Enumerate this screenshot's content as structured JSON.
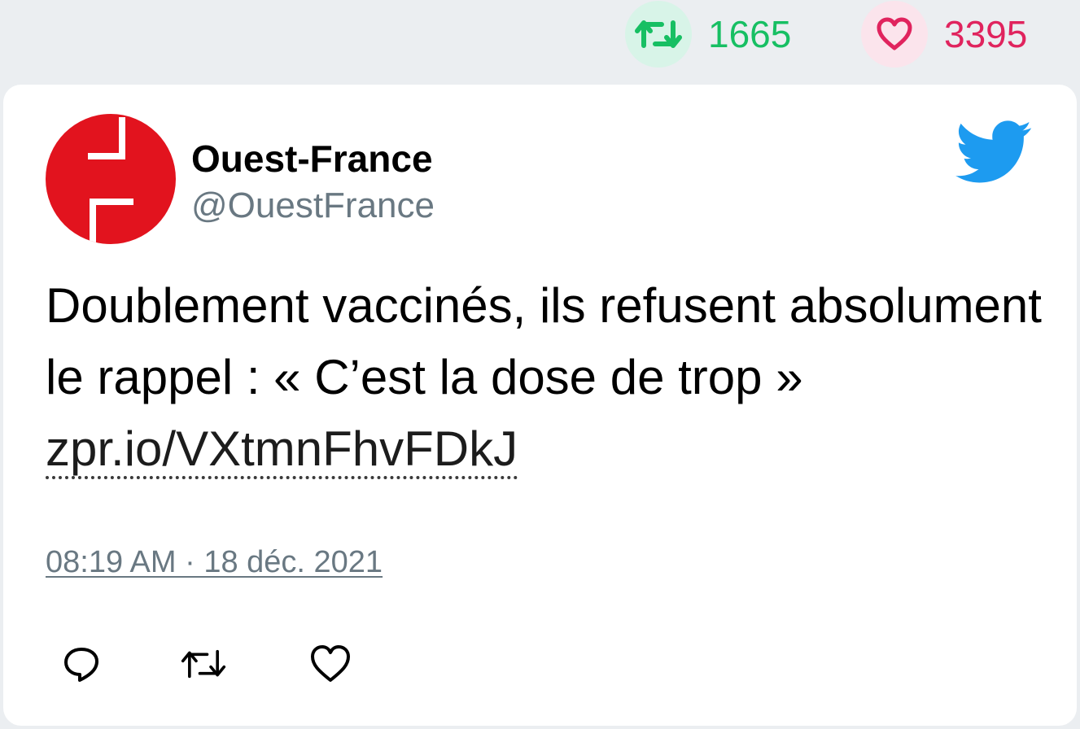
{
  "stats": {
    "retweet_count": "1665",
    "like_count": "3395"
  },
  "author": {
    "name": "Ouest-France",
    "handle": "@OuestFrance",
    "avatar_icon": "ouest-france-logo",
    "avatar_color": "#e2131e"
  },
  "tweet": {
    "text": "Doublement vaccinés, ils refusent absolument le rappel : « C’est la dose de trop » ",
    "link": "zpr.io/VXtmnFhvFDkJ",
    "timestamp": "08:19 AM · 18 déc. 2021"
  },
  "icons": {
    "retweet": "retweet-icon",
    "like": "heart-icon",
    "reply": "reply-icon",
    "brand": "twitter-bird-icon"
  },
  "colors": {
    "retweet_green": "#17bf63",
    "like_red": "#e0245e",
    "twitter_blue": "#1d9bf0",
    "muted_gray": "#697882"
  }
}
